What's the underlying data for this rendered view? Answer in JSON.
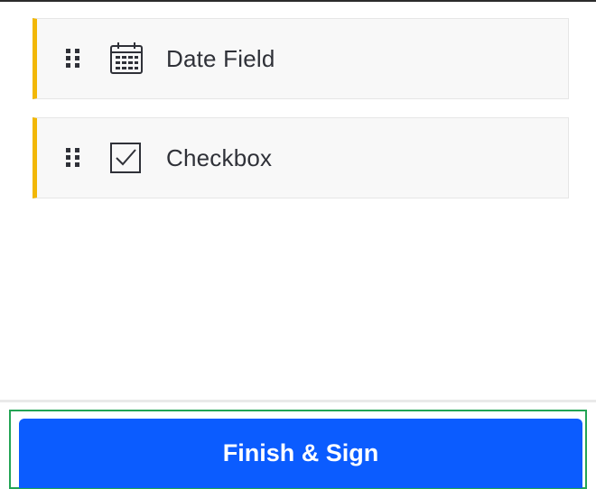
{
  "fields": [
    {
      "label": "Date Field",
      "icon": "calendar-icon"
    },
    {
      "label": "Checkbox",
      "icon": "checkbox-icon"
    }
  ],
  "footer": {
    "finish_label": "Finish & Sign"
  },
  "colors": {
    "accent_bar": "#f2b705",
    "primary_button": "#0b5cff",
    "focus_outline": "#23a455",
    "text": "#2f3138"
  }
}
